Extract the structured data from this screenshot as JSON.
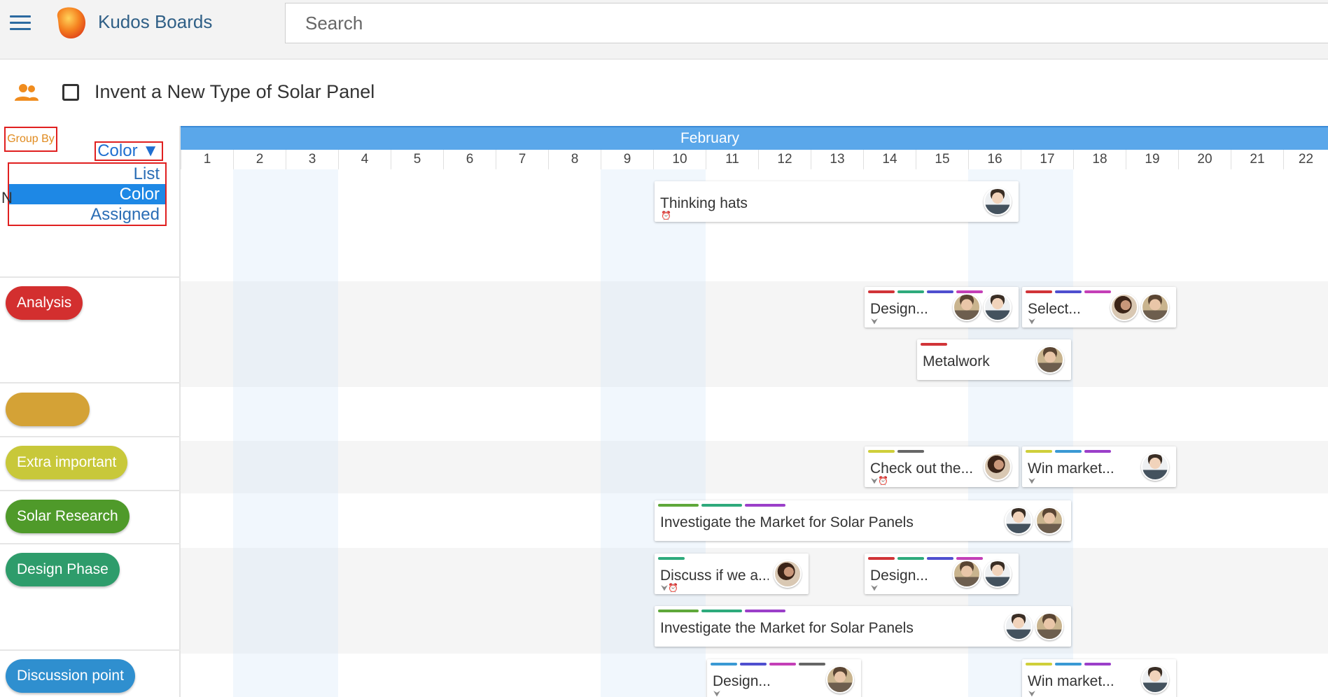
{
  "app": {
    "title": "Kudos Boards",
    "search_placeholder": "Search"
  },
  "board": {
    "title": "Invent a New Type of Solar Panel"
  },
  "groupby": {
    "label": "Group By",
    "selected": "Color ▼",
    "options": [
      "List",
      "Color",
      "Assigned"
    ]
  },
  "stray_text": "N",
  "groups": [
    {
      "label": "Analysis",
      "color": "#d32f2f"
    },
    {
      "label": "",
      "color": "#d4a236"
    },
    {
      "label": "Extra important",
      "color": "#c8c83a"
    },
    {
      "label": "Solar Research",
      "color": "#4f9a2a"
    },
    {
      "label": "Design Phase",
      "color": "#2e9c6b"
    },
    {
      "label": "Discussion point",
      "color": "#2f8fcf"
    }
  ],
  "timeline": {
    "month": "February",
    "days": [
      "1",
      "2",
      "3",
      "4",
      "5",
      "6",
      "7",
      "8",
      "9",
      "10",
      "11",
      "12",
      "13",
      "14",
      "15",
      "16",
      "17",
      "18",
      "19",
      "20",
      "21",
      "22"
    ]
  },
  "cards": {
    "thinking_hats": "Thinking hats",
    "design_a": "Design...",
    "select_a": "Select...",
    "metalwork": "Metalwork",
    "check_out": "Check out the...",
    "win_market_a": "Win market...",
    "investigate_a": "Investigate the Market for Solar Panels",
    "discuss": "Discuss if we a...",
    "design_b": "Design...",
    "investigate_b": "Investigate the Market for Solar Panels",
    "design_c": "Design...",
    "win_market_b": "Win market..."
  },
  "icons": {
    "menu": "hamburger-menu-icon",
    "people": "people-icon",
    "alarm": "alarm-clock-icon",
    "expand": "chevron-down-icon"
  },
  "tag_colors": {
    "red": "#d13438",
    "teal": "#2eaa7c",
    "indigo": "#4f4fcf",
    "magenta": "#c43fb7",
    "yellow": "#cfcf3a",
    "gray": "#666666",
    "blue": "#3a99d4",
    "purple": "#9b3fc9",
    "green": "#5fa83a"
  }
}
